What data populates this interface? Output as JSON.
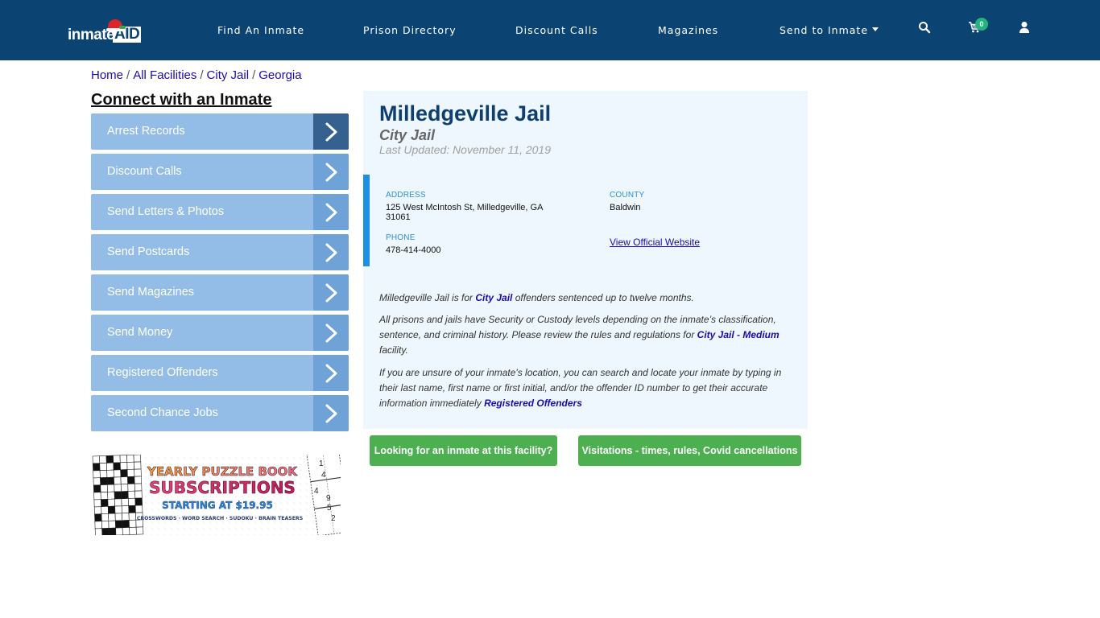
{
  "header": {
    "logo": {
      "text_main": "inmate",
      "text_accent": "AID"
    },
    "nav": [
      {
        "label": "Find An Inmate"
      },
      {
        "label": "Prison Directory"
      },
      {
        "label": "Discount Calls"
      },
      {
        "label": "Magazines"
      },
      {
        "label": "Send to Inmate",
        "has_dropdown": true
      }
    ],
    "icons": {
      "search": "search-icon",
      "cart": "cart-icon",
      "user": "user-icon"
    },
    "cart_count": "0"
  },
  "breadcrumb": [
    {
      "label": "Home"
    },
    {
      "label": "All Facilities"
    },
    {
      "label": "City Jail"
    },
    {
      "label": "Georgia"
    }
  ],
  "breadcrumb_separator": "/",
  "sidebar": {
    "title": "Connect with an Inmate",
    "items": [
      {
        "label": "Arrest Records",
        "active": true
      },
      {
        "label": "Discount Calls"
      },
      {
        "label": "Send Letters & Photos"
      },
      {
        "label": "Send Postcards"
      },
      {
        "label": "Send Magazines"
      },
      {
        "label": "Send Money"
      },
      {
        "label": "Registered Offenders"
      },
      {
        "label": "Second Chance Jobs"
      }
    ],
    "ad": {
      "line1": "YEARLY PUZZLE BOOK",
      "line2": "SUBSCRIPTIONS",
      "line3": "STARTING AT $19.95",
      "line4": "CROSSWORDS · WORD SEARCH · SUDOKU · BRAIN TEASERS",
      "sudoku_digits": [
        "1",
        "4",
        "4",
        "9",
        "5",
        "2"
      ]
    }
  },
  "facility": {
    "name": "Milledgeville Jail",
    "type": "City Jail",
    "last_updated": "Last Updated: November 11, 2019",
    "address_label": "ADDRESS",
    "address": "125 West McIntosh St, Milledgeville, GA 31061",
    "county_label": "COUNTY",
    "county": "Baldwin",
    "phone_label": "PHONE",
    "phone": "478-414-4000",
    "website_link": "View Official Website"
  },
  "description": {
    "p1_before": "Milledgeville Jail is for ",
    "p1_link": "City Jail",
    "p1_after": " offenders sentenced up to twelve months.",
    "p2_before": "All prisons and jails have Security or Custody levels depending on the inmate’s classification, sentence, and criminal history. Please review the rules and regulations for ",
    "p2_link": "City Jail - Medium",
    "p2_after": " facility.",
    "p3_before": "If you are unsure of your inmate's location, you can search and locate your inmate by typing in their last name, first name or first initial, and/or the offender ID number to get their accurate information immediately ",
    "p3_link": "Registered Offenders"
  },
  "actions": {
    "find_inmate": "Looking for an inmate at this facility?",
    "visitations": "Visitations - times, rules, Covid cancellations"
  },
  "colors": {
    "navbar": "#0b4373",
    "sidebar_item": "#93bde6",
    "sidebar_arrow": "#6fa2d6",
    "sidebar_arrow_active": "#34618f",
    "card_bg": "#eef7fd",
    "accent_bar": "#1c90e8",
    "green_button": "#4caf50",
    "badge": "#21b57f",
    "link": "#1a0dab"
  }
}
